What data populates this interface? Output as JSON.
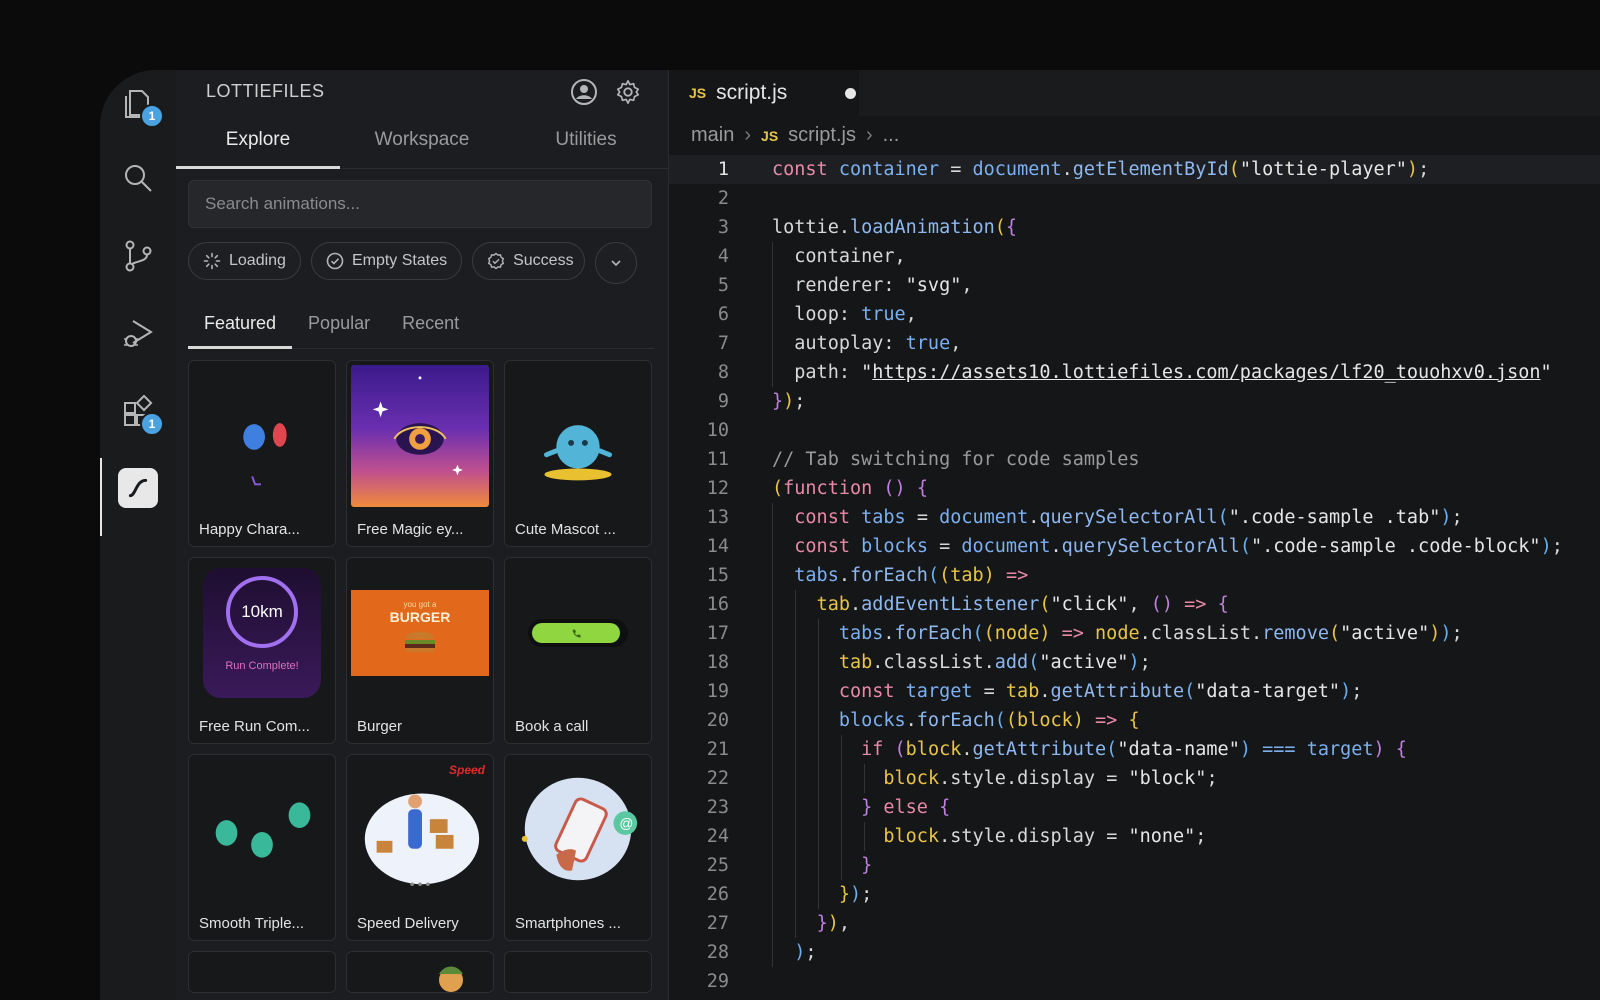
{
  "sidebar": {
    "title": "LOTTIEFILES",
    "tabs": [
      "Explore",
      "Workspace",
      "Utilities"
    ],
    "search_placeholder": "Search animations...",
    "chips": [
      "Loading",
      "Empty States",
      "Success"
    ],
    "subtabs": [
      "Featured",
      "Popular",
      "Recent"
    ],
    "cards": [
      {
        "label": "Happy Chara..."
      },
      {
        "label": "Free Magic ey..."
      },
      {
        "label": "Cute Mascot ..."
      },
      {
        "label": "Free Run Com..."
      },
      {
        "label": "Burger"
      },
      {
        "label": "Book a call"
      },
      {
        "label": "Smooth Triple..."
      },
      {
        "label": "Speed Delivery"
      },
      {
        "label": "Smartphones ..."
      }
    ],
    "thumb_text": {
      "run_km": "10km",
      "run_complete": "Run Complete!",
      "burger": "BURGER",
      "burger_small": "you got a",
      "speed": "Speed"
    }
  },
  "activity_bar": {
    "explorer_badge": "1",
    "extensions_badge": "1"
  },
  "editor": {
    "tab": {
      "lang": "JS",
      "filename": "script.js"
    },
    "breadcrumb": {
      "branch": "main",
      "lang": "JS",
      "file": "script.js",
      "more": "..."
    },
    "current_line": 1
  },
  "colors": {
    "accent": "#4aa3e0",
    "keyword": "#e88aa6",
    "function": "#8fb8f0",
    "bracket_yellow": "#e8c547",
    "bracket_purple": "#c080e0"
  }
}
